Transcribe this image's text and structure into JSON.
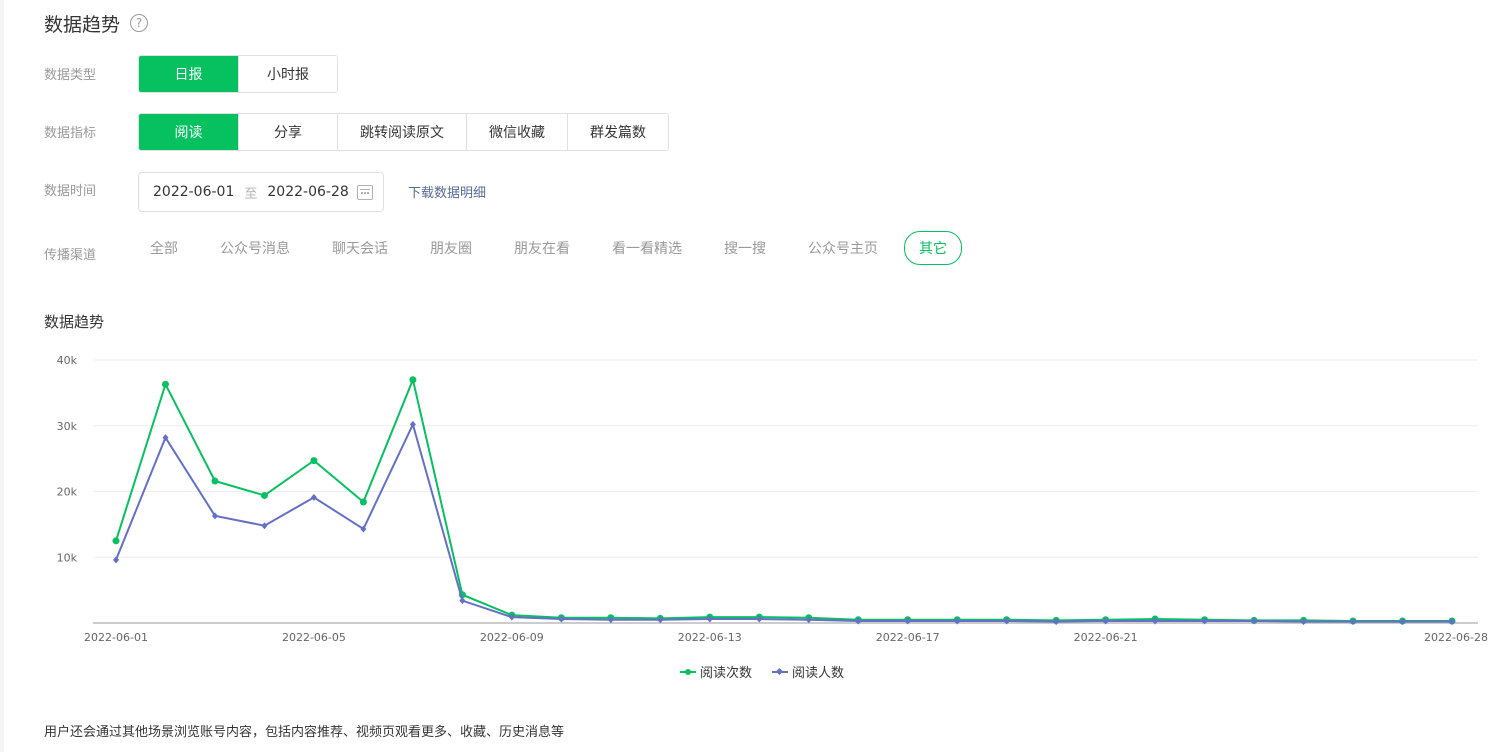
{
  "header": {
    "title": "数据趋势",
    "help_icon": "question-circle-icon"
  },
  "filters": {
    "data_type": {
      "label": "数据类型",
      "options": [
        "日报",
        "小时报"
      ],
      "selected": "日报"
    },
    "metric": {
      "label": "数据指标",
      "options": [
        "阅读",
        "分享",
        "跳转阅读原文",
        "微信收藏",
        "群发篇数"
      ],
      "selected": "阅读"
    },
    "time": {
      "label": "数据时间",
      "start": "2022-06-01",
      "separator": "至",
      "end": "2022-06-28",
      "download_link": "下载数据明细"
    },
    "channel": {
      "label": "传播渠道",
      "options": [
        "全部",
        "公众号消息",
        "聊天会话",
        "朋友圈",
        "朋友在看",
        "看一看精选",
        "搜一搜",
        "公众号主页",
        "其它"
      ],
      "selected": "其它"
    }
  },
  "chart_section": {
    "title": "数据趋势"
  },
  "chart_data": {
    "type": "line",
    "x": [
      "2022-06-01",
      "2022-06-02",
      "2022-06-03",
      "2022-06-04",
      "2022-06-05",
      "2022-06-06",
      "2022-06-07",
      "2022-06-08",
      "2022-06-09",
      "2022-06-10",
      "2022-06-11",
      "2022-06-12",
      "2022-06-13",
      "2022-06-14",
      "2022-06-15",
      "2022-06-16",
      "2022-06-17",
      "2022-06-18",
      "2022-06-19",
      "2022-06-20",
      "2022-06-21",
      "2022-06-22",
      "2022-06-23",
      "2022-06-24",
      "2022-06-25",
      "2022-06-26",
      "2022-06-27",
      "2022-06-28"
    ],
    "x_tick_labels": [
      "2022-06-01",
      "2022-06-05",
      "2022-06-09",
      "2022-06-13",
      "2022-06-17",
      "2022-06-21",
      "2022-06-28"
    ],
    "y_ticks": [
      10000,
      20000,
      30000,
      40000
    ],
    "y_tick_labels": [
      "10k",
      "20k",
      "30k",
      "40k"
    ],
    "ylim": [
      0,
      40000
    ],
    "grid": true,
    "legend": "bottom-center",
    "series": [
      {
        "name": "阅读次数",
        "color": "#07c160",
        "marker": "circle",
        "values": [
          12500,
          36300,
          21600,
          19400,
          24700,
          18400,
          37000,
          4300,
          1200,
          800,
          800,
          700,
          900,
          900,
          800,
          500,
          500,
          500,
          500,
          400,
          500,
          600,
          500,
          400,
          400,
          300,
          300,
          300
        ]
      },
      {
        "name": "阅读人数",
        "color": "#6470c8",
        "marker": "diamond",
        "values": [
          9600,
          28200,
          16300,
          14800,
          19100,
          14300,
          30200,
          3400,
          900,
          600,
          500,
          500,
          600,
          600,
          500,
          300,
          300,
          300,
          300,
          200,
          300,
          300,
          300,
          300,
          200,
          200,
          200,
          200
        ]
      }
    ]
  },
  "footnote": "用户还会通过其他场景浏览账号内容，包括内容推荐、视频页观看更多、收藏、历史消息等"
}
